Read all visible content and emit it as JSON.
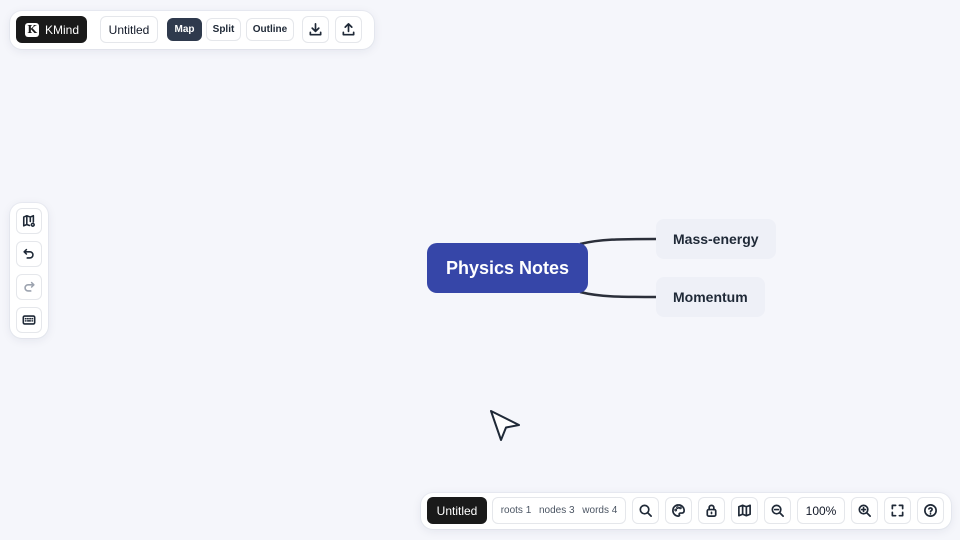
{
  "app": {
    "brand": "KMind",
    "brand_mark": "K",
    "doc_title": "Untitled"
  },
  "view_modes": [
    {
      "label": "Map",
      "active": true
    },
    {
      "label": "Split",
      "active": false
    },
    {
      "label": "Outline",
      "active": false
    }
  ],
  "top_icons": [
    "download-icon",
    "upload-icon"
  ],
  "left_tools": [
    "map-settings-icon",
    "undo-icon",
    "redo-icon",
    "keyboard-icon"
  ],
  "mindmap": {
    "root": "Physics Notes",
    "children": [
      "Mass-energy",
      "Momentum"
    ]
  },
  "bottom": {
    "title": "Untitled",
    "stats": {
      "roots": "roots 1",
      "nodes": "nodes 3",
      "words": "words 4"
    },
    "zoom": "100%"
  },
  "colors": {
    "root_fill": "#3646a8",
    "child_fill": "#eef0f7",
    "canvas": "#f5f6fb",
    "dark": "#1a1a1a"
  }
}
